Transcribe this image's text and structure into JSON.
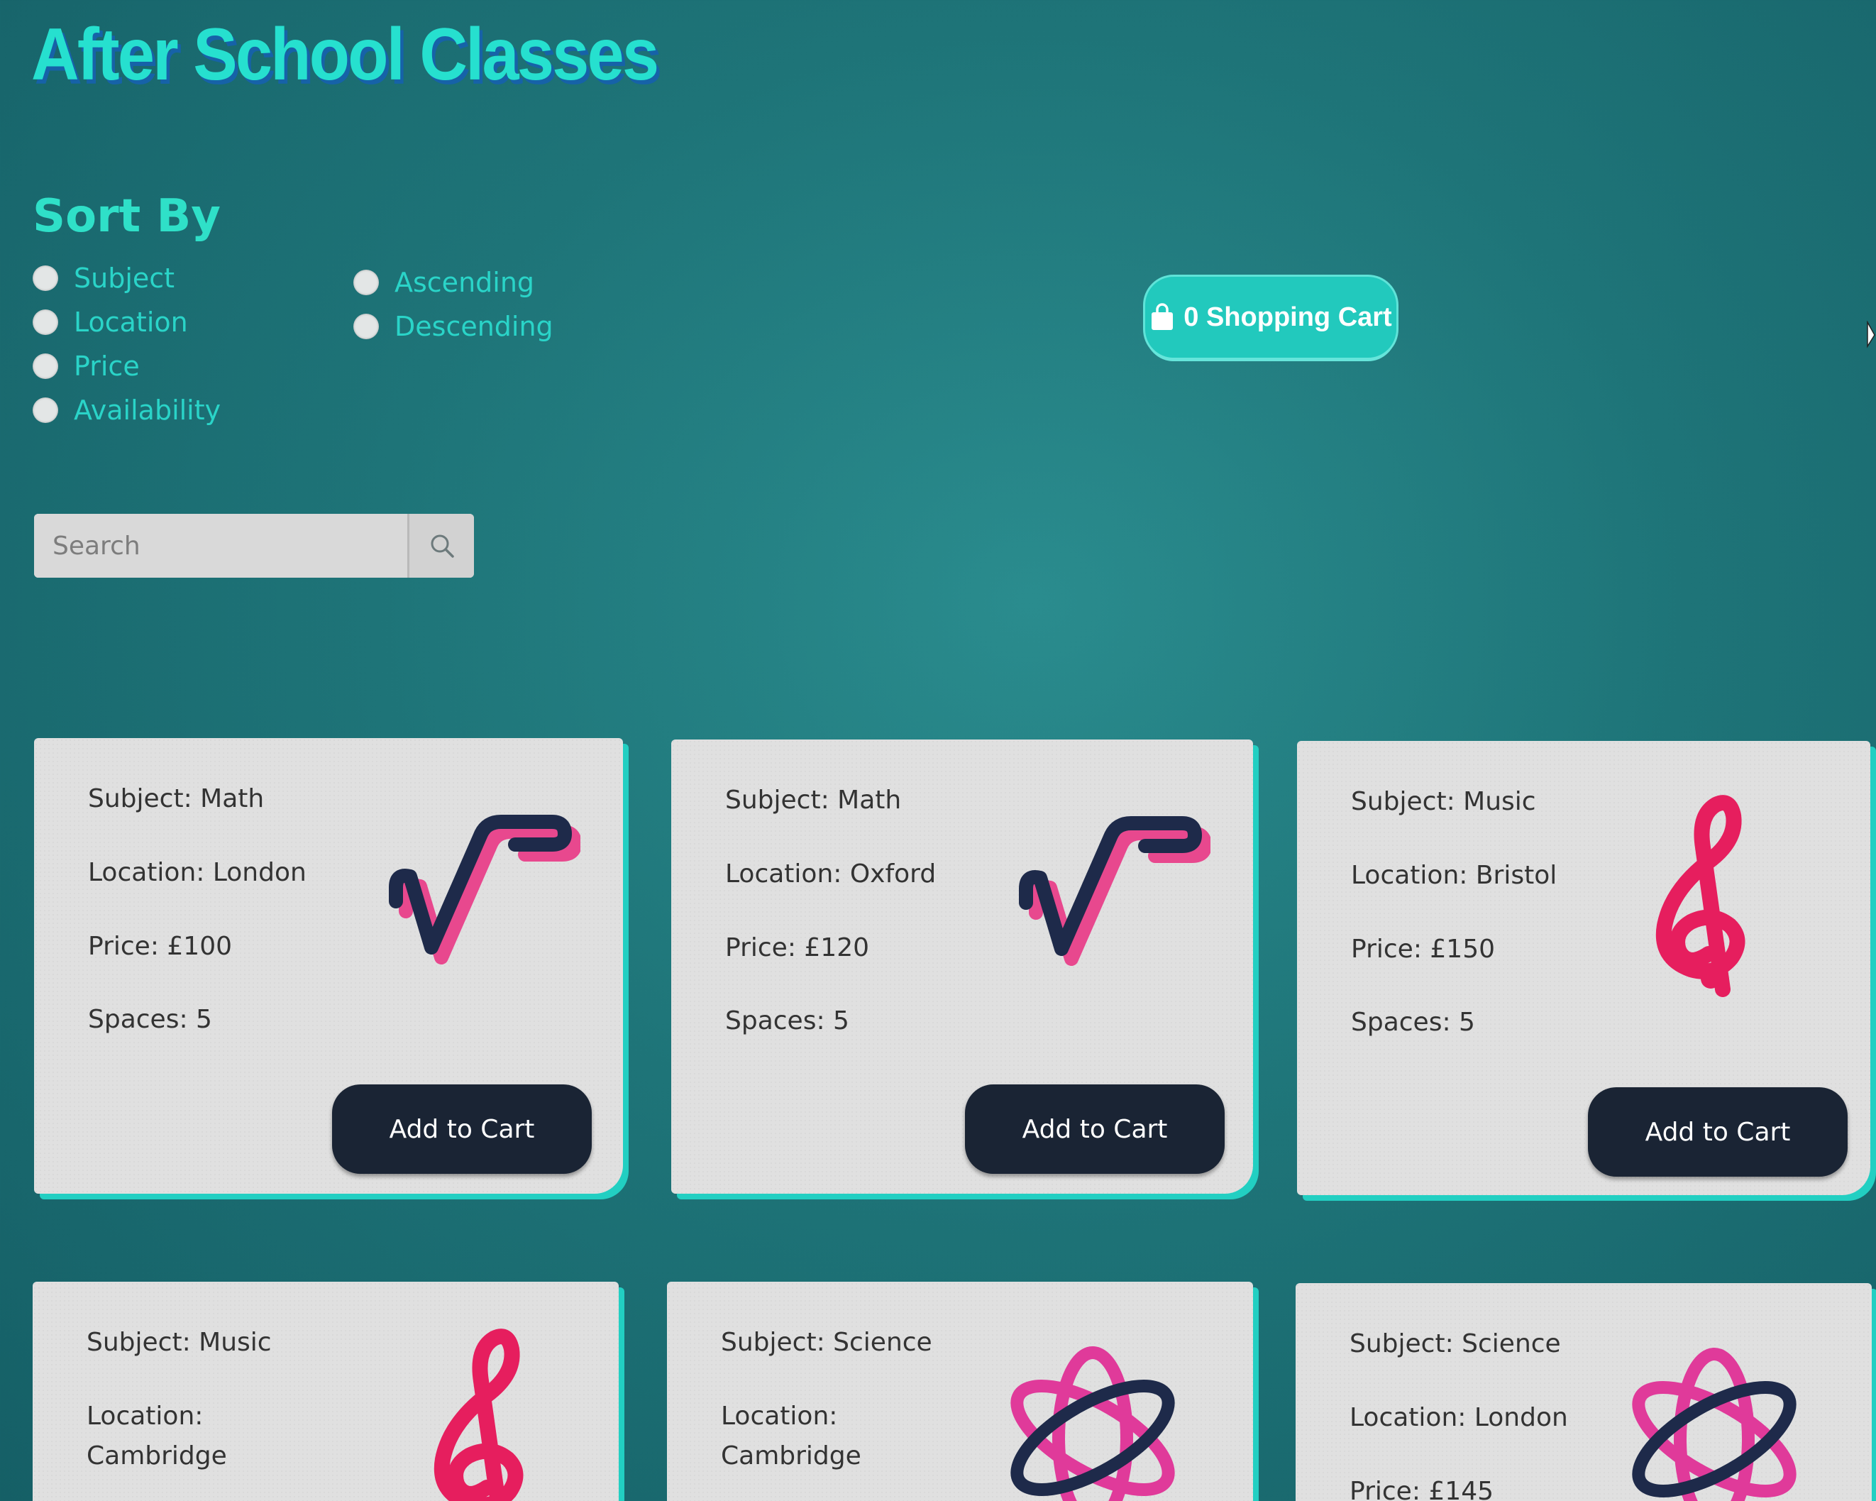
{
  "app": {
    "title": "After School Classes"
  },
  "sort": {
    "heading": "Sort By",
    "fields": [
      "Subject",
      "Location",
      "Price",
      "Availability"
    ],
    "order": [
      "Ascending",
      "Descending"
    ]
  },
  "cart": {
    "label": "0 Shopping Cart",
    "icon": "shopping-bag-icon"
  },
  "search": {
    "placeholder": "Search",
    "icon": "search-icon"
  },
  "lessons": [
    {
      "subject": "Subject: Math",
      "location": "Location: London",
      "price": "Price: £100",
      "spaces": "Spaces: 5",
      "icon": "math-root-icon",
      "button": "Add to Cart"
    },
    {
      "subject": "Subject: Math",
      "location": "Location: Oxford",
      "price": "Price: £120",
      "spaces": "Spaces: 5",
      "icon": "math-root-icon",
      "button": "Add to Cart"
    },
    {
      "subject": "Subject: Music",
      "location": "Location: Bristol",
      "price": "Price: £150",
      "spaces": "Spaces: 5",
      "icon": "treble-clef-icon",
      "button": "Add to Cart"
    },
    {
      "subject": "Subject: Music",
      "location": "Location: Cambridge",
      "icon": "treble-clef-icon"
    },
    {
      "subject": "Subject: Science",
      "location": "Location: Cambridge",
      "icon": "atom-icon"
    },
    {
      "subject": "Subject: Science",
      "location": "Location: London",
      "price": "Price: £145",
      "icon": "atom-icon"
    }
  ],
  "colors": {
    "background": "#1e7478",
    "accent": "#22cfc2",
    "title": "#26e0cf",
    "title_shadow": "#1662a8",
    "button_dark": "#1a2434",
    "icon_navy": "#1e2a4a",
    "icon_pink": "#e8287a"
  }
}
